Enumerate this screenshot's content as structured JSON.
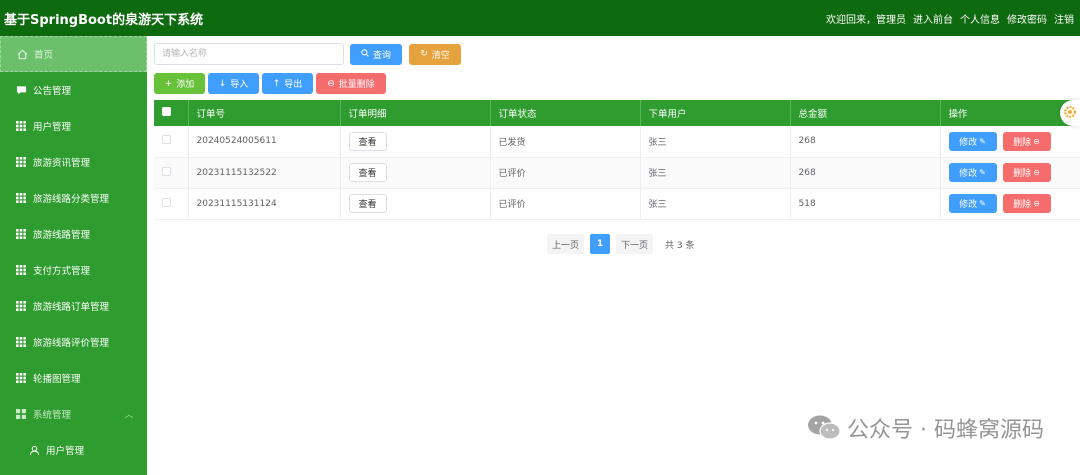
{
  "header": {
    "title": "基于SpringBoot的泉游天下系统",
    "welcome": "欢迎回来，管理员",
    "links": [
      "进入前台",
      "个人信息",
      "修改密码",
      "注销"
    ]
  },
  "sidebar": {
    "items": [
      {
        "label": "首页",
        "icon": "home-icon"
      },
      {
        "label": "公告管理",
        "icon": "comment-icon"
      },
      {
        "label": "用户管理",
        "icon": "grid-icon"
      },
      {
        "label": "旅游资讯管理",
        "icon": "grid-icon"
      },
      {
        "label": "旅游线路分类管理",
        "icon": "grid-icon"
      },
      {
        "label": "旅游线路管理",
        "icon": "grid-icon"
      },
      {
        "label": "支付方式管理",
        "icon": "grid-icon"
      },
      {
        "label": "旅游线路订单管理",
        "icon": "grid-icon"
      },
      {
        "label": "旅游线路评价管理",
        "icon": "grid-icon"
      },
      {
        "label": "轮播图管理",
        "icon": "grid-icon"
      },
      {
        "label": "系统管理",
        "icon": "apps-icon"
      },
      {
        "label": "用户管理",
        "icon": "user-icon"
      }
    ]
  },
  "search": {
    "placeholder": "请输入名称",
    "query_label": "查询",
    "clear_label": "清空"
  },
  "actions": {
    "add": "添加",
    "import": "导入",
    "export": "导出",
    "batch_delete": "批量删除"
  },
  "table": {
    "headers": [
      "订单号",
      "订单明细",
      "订单状态",
      "下单用户",
      "总金额",
      "操作"
    ],
    "rows": [
      {
        "order_no": "20240524005611",
        "detail": "查看",
        "status": "已发货",
        "user": "张三",
        "total": "268"
      },
      {
        "order_no": "20231115132522",
        "detail": "查看",
        "status": "已评价",
        "user": "张三",
        "total": "268"
      },
      {
        "order_no": "20231115131124",
        "detail": "查看",
        "status": "已评价",
        "user": "张三",
        "total": "518"
      }
    ],
    "edit_label": "修改",
    "delete_label": "删除"
  },
  "pagination": {
    "prev": "上一页",
    "current": "1",
    "next": "下一页",
    "total": "共 3 条"
  },
  "watermark": {
    "text": "公众号 · 码蜂窝源码"
  },
  "colors": {
    "header": "#0e6a0e",
    "sidebar": "#2e9c2e",
    "primary": "#409eff",
    "success": "#67c23a",
    "warning": "#e6a23c",
    "danger": "#f56c6c"
  }
}
